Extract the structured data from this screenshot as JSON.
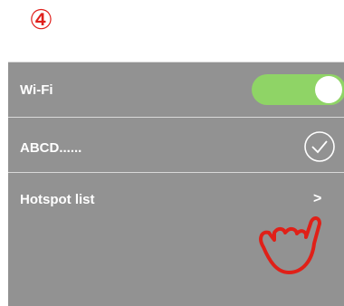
{
  "step_marker": "④",
  "wifi": {
    "label": "Wi-Fi",
    "enabled": true
  },
  "network": {
    "name": "ABCD......",
    "connected": true
  },
  "hotspot": {
    "label": "Hotspot list",
    "chevron": ">"
  },
  "icons": {
    "connected": "check-circle-icon",
    "pointer": "pointing-hand-icon"
  },
  "colors": {
    "panel": "#929292",
    "toggle_on": "#8fd466",
    "step_marker": "#e0201c",
    "hand": "#e02018"
  }
}
